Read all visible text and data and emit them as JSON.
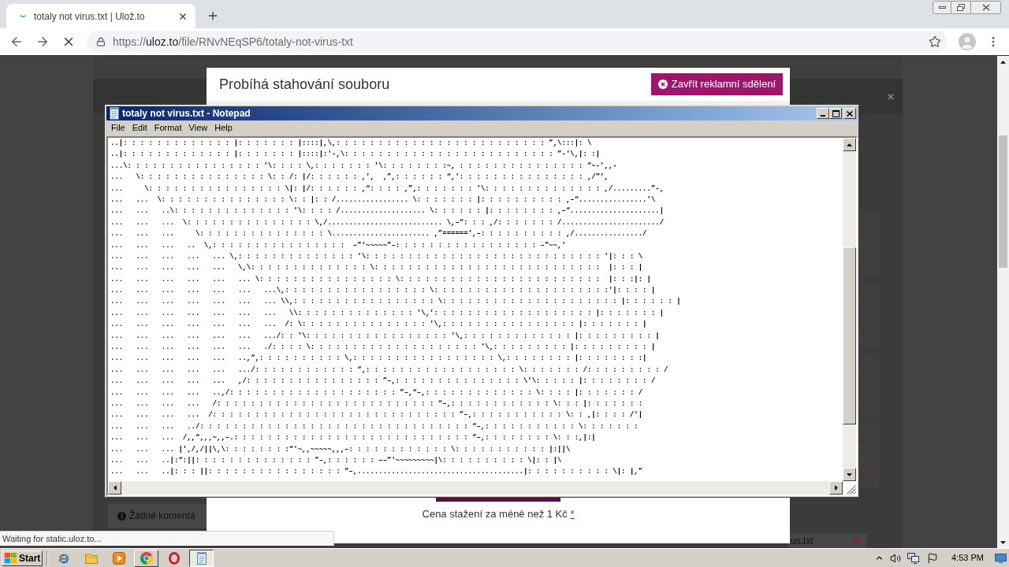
{
  "browser": {
    "tab": {
      "title": "totaly not virus.txt | Ulož.to",
      "loading": true
    },
    "address": {
      "scheme": "https://",
      "host": "uloz.to",
      "path": "/file/RNvNEqSP6/totaly-not-virus-txt"
    },
    "status": "Waiting for static.uloz.to..."
  },
  "page": {
    "modal": {
      "title": "Probíhá stahování souboru",
      "close_button": "Zavřít reklamní sdělení",
      "price_note": "Cena stažení za méně než 1 Kč",
      "price_link": "*"
    },
    "comments": "Žádné komentá",
    "file_name": "us.txt"
  },
  "notepad": {
    "title": "totaly not virus.txt - Notepad",
    "menu": [
      "File",
      "Edit",
      "Format",
      "View",
      "Help"
    ],
    "lines": [
      "..|: : : : : : : : : : : : : |: : : : : : : |::::|,\\,: : : : : : : : : : : : : : : : : : : : : : : : : ”,\\:::|: \\",
      "..|: : : : : : : : : : : : : |: : : : : : : |::::|:'-,\\: : : : : : : : : : : : : : : : : : : : : : : : : ”-'\\,|: :|",
      "...\\: : : : : : : : : : : : : : : : '\\: : : : \\,: : : : : : : '\\: : : : : : : :~, : : : : : : : : : : : : : : : “~-',,-",
      "...   \\: : : : : : : : : : : : : : : \\: : /: |/: : : : : : ,',  ,”,: : : : : : “,': : : : : : : : : : : : : : : ,/”',",
      "...     \\: : : : : : : : : : : : : : : : \\|: |/: : : : : : ,“: : : : ,”,: : : : : : : '\\: : : : : : : : : : : : : : ,/.........”-,",
      "...   ...  \\: : : : : : : : : : : : : : : \\: : |: : /................. \\: : : : : : : |: : : : : : : : : : ,–“................'\\",
      "...   ...   ..\\: : : : : : : : : : : : : : '\\: : : : /.................... \\: : : : : : |: : : : : : : : ,–“.....................|",
      "...   ...   ...  \\: : : : : : : : : : : : : : : \\,/........................... \\,–“: : : ,/: : : : : : : /......................./",
      "...   ...   ...     \\: : : : : : : : : : : : : : : \\....................... ,”======',–: : : : : : : : : : ,/................/",
      "...   ...   ...   ..  \\,: : : : : : : : : : : : : : : :  –”'~~~~~”–: : : : : : : : : : : : : : : : : –”~~,'",
      "...   ...   ...   ...   ... \\,: : : : : : : : : : : : : : '\\: : : : : : : : : : : : : : : : : : : : : : : : : : : : '|: : : \\",
      "...   ...   ...   ...   ...   \\,\\: : : : : : : : : : : : : : \\: : : : : : : : : : : : : : : : : : : : : : : : : : :  |: : : |",
      "...   ...   ...   ...   ...   ... \\: : : : : : : : : : : : : : : : \\: : : : : : : : : : : : : : : : : : : : : : : :  |: : :|: |",
      "...   ...   ...   ...   ...   ...   ...\\,: : : : : : : : : : : : : : : : : \\: : : : : : : : : : : : : : : : : : : : :'|: : : : |",
      "...   ...   ...   ...   ...   ...   ... \\\\,: : : : : : : : : : : : : : : : : \\: : : : : : : : : : : : : : : : : : : : : |: : : : : : |",
      "...   ...   ...   ...   ...   ...   ...   \\\\: : : : : : : : : : : : : : '\\,': : : : : : : : : : : : : : : : : : : |: : : : : : : |",
      "...   ...   ...   ...   ...   ...   ...  /: \\: : : : : : : : : : : : : : : '\\,: : : : : : : : : : : : : : : : |: : : : : : : |",
      "...   ...   ...   ...   ...   ...   .../: : '\\: : : : : : : : : : : : : : : : : '\\,: : : : : : : : : : : : : |: : : : : : : : : |",
      "...   ...   ...   ...   ...   ...   ./: : : : \\: : : : : : : : : : : : : : : : : : : : '\\,: : : : : : : : : |: : : : : : : : : |",
      "...   ...   ...   ...   ...   ..,“,: : : : : : : : : : \\,: : : : : : : : : : : : : : : : : \\,: : : : : : : : |: : : : : : : :|",
      "...   ...   ...   ...   ...   .../: : : : : : : : : : : : “,: : : : : : : : : : : : : : : : : : \\: : : : : : : /: : : : : : : : : /",
      "...   ...   ...   ...   ...   ,/: : : : : : : : : : : : : : : : ”–,: : : : : : : : : : : : : : : \\'\\: : : : : |: : : : : : : : /",
      "...   ...   ...   ...   ..,/: : : : : : : : : : : : : : : : : : : : ”–,“–,: : : : : : : : : : : : : \\: : : : |: : : : : : : /",
      "...   ...   ...   ...   /: : : : : : : : : : : : : : : : : : : : : : : : : : “–,: : : : : : : : : : : : \\: : : |: : : : : : :",
      "...   ...   ...   ...  /: : : : : : : : : : : : : : : : : : : : : : : : : : : : : ”–,: : : : : : : : : : : \\: : ,|: : : : /'|",
      "...   ...   ...   ../: : : : : : : : : : : : : : : : : : : : : : : : : : : : : : : : “–,: : : : : : : : : : : \\: : : : : : :",
      "...   ...   ...  /,,“,,,~,,–.: : : : : : : : : : : : : : : : : : : : : : : : : : : : “–,: : : : : : : : \\: : :,|:|",
      "...   ...   ... |',/,/||\\,\\: : : : : : : :“'~,,~~~~~,,,–: : : : : : : : : : : : \\: : : : : : : : : : : |:||\\",
      "...   ...   ..|:“:||: : : : : : : : : : : : : : ”–,: : : : : : ––”'~~~~~~~~~|\\: : : : : : : : : : \\|: : |\\",
      "...   ...   ..|: : : ||: : : : : : : : : : : : : : : : ”–,.......................................|: : : : : : : : : : \\|: |,”"
    ]
  },
  "taskbar": {
    "start": "Start",
    "apps": [
      {
        "kind": "ie",
        "running": false,
        "selected": false
      },
      {
        "kind": "folder",
        "running": false,
        "selected": false
      },
      {
        "kind": "media",
        "running": false,
        "selected": false
      },
      {
        "kind": "chrome",
        "running": true,
        "selected": false
      },
      {
        "kind": "opera",
        "running": false,
        "selected": false
      },
      {
        "kind": "notepad",
        "running": true,
        "selected": true
      }
    ],
    "clock": "4:53 PM"
  }
}
